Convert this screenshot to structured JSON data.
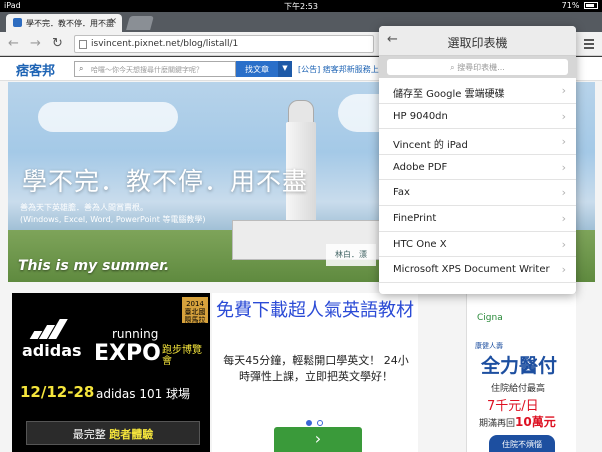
{
  "status": {
    "device": "iPad",
    "time": "下午2:53",
    "battery": "71%"
  },
  "tabs": [
    {
      "title": "學不完．教不停．用不盡"
    }
  ],
  "toolbar": {
    "url": "isvincent.pixnet.net/blog/listall/1"
  },
  "site": {
    "logo": "痞客邦",
    "search_placeholder": "哈囉～你今天想搜尋什麼關鍵字呢？",
    "find_label": "找文章",
    "notice": "[公告] 痞客邦新服務上"
  },
  "banner": {
    "title": "學不完．教不停．用不盡",
    "sub1": "善為天下英雄膽．善為人間賞賣根。",
    "sub2": "(Windows, Excel, Word, PowerPoint 等電腦教學)",
    "slogan": "This is my summer.",
    "sign": "林白．漂"
  },
  "ad_left": {
    "brand": "adidas",
    "badge": "2014 臺北國際馬拉松",
    "running": "running",
    "expo": "EXPO",
    "expo_tag": "跑步博覽會",
    "date": "12/12-28",
    "venue": "adidas 101 球場",
    "cta_prefix": "最完整",
    "cta_highlight": "跑者體驗",
    "cta_suffix": ""
  },
  "ad_mid": {
    "headline": "免費下載超人氣英語教材",
    "body": "每天45分鐘，輕鬆開口學英文！ 24小時彈性上課，立即把英文學好！",
    "go": "›"
  },
  "ad_right": {
    "brand": "Cigna",
    "t1": "康健人壽",
    "t2": "全力醫付",
    "t3": "住院給付最高",
    "t4": "7千元/日",
    "t5_prefix": "期滿再回",
    "t5_highlight": "10萬元",
    "btn": "住院不煩惱"
  },
  "printer_popup": {
    "title": "選取印表機",
    "search_placeholder": "搜尋印表機...",
    "printers": [
      "儲存至 Google 雲端硬碟",
      "HP 9040dn",
      "Vincent 的 iPad",
      "Adobe PDF",
      "Fax",
      "FinePrint",
      "HTC One X",
      "Microsoft XPS Document Writer"
    ]
  }
}
